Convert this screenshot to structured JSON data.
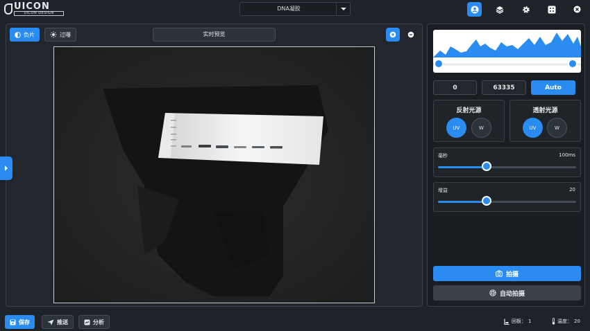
{
  "header": {
    "logo_text": "UICON",
    "logo_subtext": "UICON DESIGN",
    "dropdown_value": "DNA凝胶",
    "icons": [
      "user-icon",
      "layers-icon",
      "gear-icon",
      "grid-icon",
      "close-icon"
    ]
  },
  "viewer": {
    "negative_label": "负片",
    "filter_label": "过曝",
    "preview_label": "实时预览"
  },
  "panel": {
    "min_value": "0",
    "max_value": "63335",
    "auto_label": "Auto",
    "reflect": {
      "title": "反射光源",
      "uv": "UV",
      "w": "W"
    },
    "transmit": {
      "title": "透射光源",
      "uv": "UV",
      "w": "W"
    },
    "exposure": {
      "label": "毫秒",
      "value": "100ms",
      "level": 0.35
    },
    "gain": {
      "label": "增益",
      "value": "20",
      "level": 0.35
    },
    "capture_label": "拍摄",
    "auto_capture_label": "自动拍摄"
  },
  "footer": {
    "save_label": "保存",
    "send_label": "推送",
    "analyze_label": "分析",
    "tray_label": "回板：",
    "tray_value": "1",
    "temp_label": "温度：",
    "temp_value": "20"
  },
  "colors": {
    "accent": "#2a8cf0",
    "background": "#1e2329"
  }
}
